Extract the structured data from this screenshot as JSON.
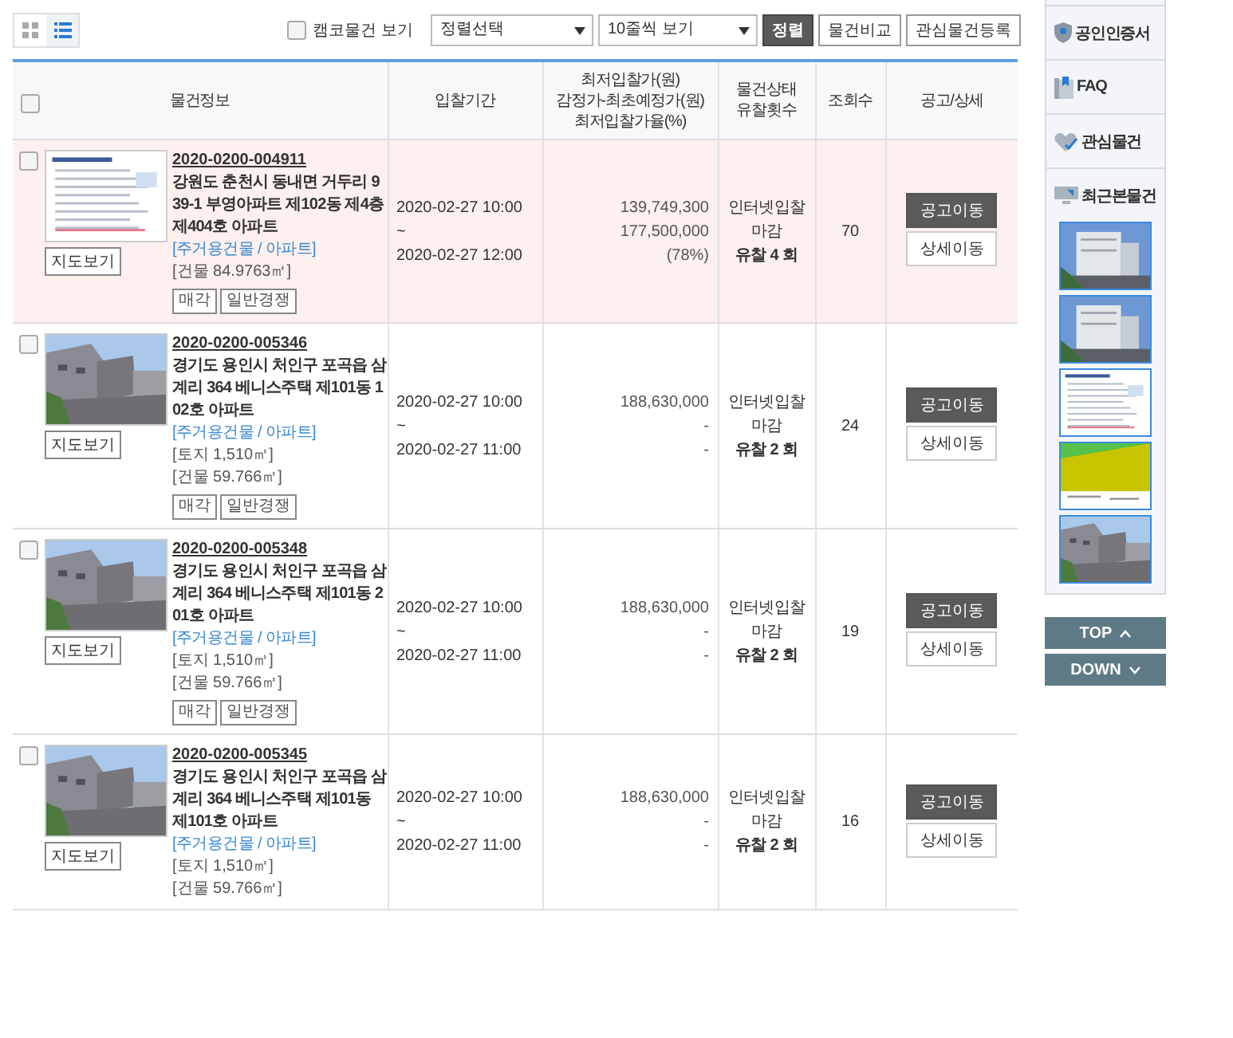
{
  "toolbar": {
    "view_toggles": [
      {
        "kind": "grid",
        "selected": false
      },
      {
        "kind": "list",
        "selected": true
      }
    ],
    "kamco_filter": {
      "label": "캠코물건 보기",
      "checked": false
    },
    "sort_select": {
      "value": "정렬선택"
    },
    "page_size_select": {
      "value": "10줄씩 보기"
    },
    "buttons": [
      {
        "label": "정렬",
        "kind": "primary"
      },
      {
        "label": "물건비교",
        "kind": "default"
      },
      {
        "label": "관심물건등록",
        "kind": "default"
      }
    ]
  },
  "table": {
    "select_all": {
      "checked": false
    },
    "columns": [
      {
        "lines": [
          "물건정보"
        ]
      },
      {
        "lines": [
          "입찰기간"
        ]
      },
      {
        "lines": [
          "최저입찰가(원)",
          "감정가-최초예정가(원)",
          "최저입찰가율(%)"
        ]
      },
      {
        "lines": [
          "물건상태",
          "유찰횟수"
        ]
      },
      {
        "lines": [
          "조회수"
        ]
      },
      {
        "lines": [
          "공고/상세"
        ]
      }
    ],
    "rows": [
      {
        "selected": true,
        "checked": false,
        "map_button": "지도보기",
        "case_no": "2020-0200-004911",
        "address": "강원도 춘천시 동내면 거두리 939-1 부영아파트 제102동 제4층 제404호 아파트",
        "category": "[주거용건물 / 아파트]",
        "areas": [
          "[건물 84.9763㎡]"
        ],
        "tags": [
          "매각",
          "일반경쟁"
        ],
        "period": [
          "2020-02-27 10:00",
          "~",
          "2020-02-27 12:00"
        ],
        "prices": [
          "139,749,300",
          "177,500,000",
          "(78%)"
        ],
        "status": [
          "인터넷입찰",
          "마감"
        ],
        "fail_count": "유찰 4 회",
        "views": "70",
        "actions": [
          "공고이동",
          "상세이동"
        ]
      },
      {
        "selected": false,
        "checked": false,
        "map_button": "지도보기",
        "case_no": "2020-0200-005346",
        "address": "경기도 용인시 처인구 포곡읍 삼계리 364 베니스주택 제101동 102호 아파트",
        "category": "[주거용건물 / 아파트]",
        "areas": [
          "[토지 1,510㎡]",
          "[건물 59.766㎡]"
        ],
        "tags": [
          "매각",
          "일반경쟁"
        ],
        "period": [
          "2020-02-27 10:00",
          "~",
          "2020-02-27 11:00"
        ],
        "prices": [
          "188,630,000",
          "-",
          "-"
        ],
        "status": [
          "인터넷입찰",
          "마감"
        ],
        "fail_count": "유찰 2 회",
        "views": "24",
        "actions": [
          "공고이동",
          "상세이동"
        ]
      },
      {
        "selected": false,
        "checked": false,
        "map_button": "지도보기",
        "case_no": "2020-0200-005348",
        "address": "경기도 용인시 처인구 포곡읍 삼계리 364 베니스주택 제101동 201호 아파트",
        "category": "[주거용건물 / 아파트]",
        "areas": [
          "[토지 1,510㎡]",
          "[건물 59.766㎡]"
        ],
        "tags": [
          "매각",
          "일반경쟁"
        ],
        "period": [
          "2020-02-27 10:00",
          "~",
          "2020-02-27 11:00"
        ],
        "prices": [
          "188,630,000",
          "-",
          "-"
        ],
        "status": [
          "인터넷입찰",
          "마감"
        ],
        "fail_count": "유찰 2 회",
        "views": "19",
        "actions": [
          "공고이동",
          "상세이동"
        ]
      },
      {
        "selected": false,
        "checked": false,
        "map_button": "지도보기",
        "case_no": "2020-0200-005345",
        "address": "경기도 용인시 처인구 포곡읍 삼계리 364 베니스주택 제101동 제101호 아파트",
        "category": "[주거용건물 / 아파트]",
        "areas": [
          "[토지 1,510㎡]",
          "[건물 59.766㎡]"
        ],
        "period": [
          "2020-02-27 10:00",
          "~",
          "2020-02-27 11:00"
        ],
        "prices": [
          "188,630,000",
          "-",
          "-"
        ],
        "status": [
          "인터넷입찰",
          "마감"
        ],
        "fail_count": "유찰 2 회",
        "views": "16",
        "actions": [
          "공고이동",
          "상세이동"
        ]
      }
    ]
  },
  "sidebar": {
    "items": [
      {
        "kind": "certificate",
        "label": "공인인증서"
      },
      {
        "kind": "faq",
        "label": "FAQ"
      },
      {
        "kind": "favorites",
        "label": "관심물건"
      },
      {
        "kind": "recent",
        "label": "최근본물건"
      }
    ],
    "scroll_buttons": [
      {
        "label": "TOP",
        "kind": "up"
      },
      {
        "label": "DOWN",
        "kind": "down"
      }
    ]
  }
}
